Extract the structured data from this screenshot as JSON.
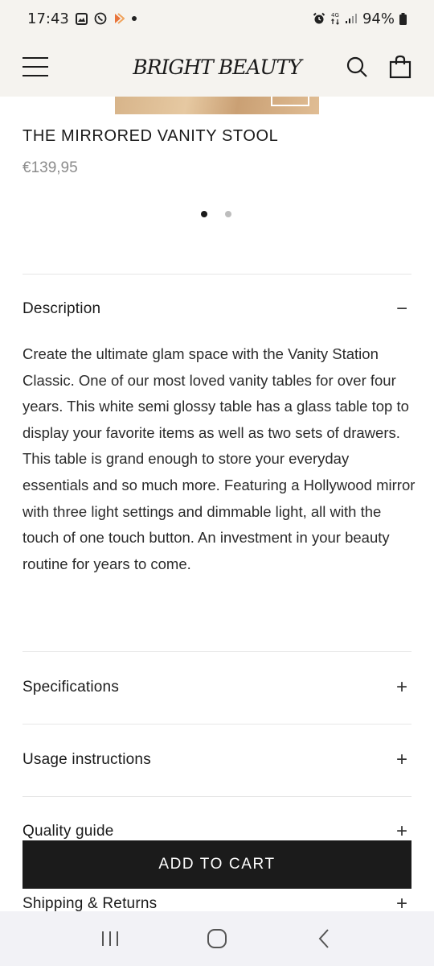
{
  "status_bar": {
    "time": "17:43",
    "battery": "94%"
  },
  "header": {
    "brand": "BRIGHT BEAUTY",
    "menu_icon": "menu-icon",
    "search_icon": "search-icon",
    "bag_icon": "shopping-bag-icon"
  },
  "product": {
    "title": "THE MIRRORED VANITY STOOL",
    "price": "€139,95",
    "carousel": {
      "count": 2,
      "active_index": 1
    }
  },
  "description": {
    "label": "Description",
    "expanded_sign": "−",
    "text": "Create the ultimate glam space with the Vanity Station Classic. One of our most loved vanity tables for over four years. This white semi glossy table has a glass table top to display your favorite items as well as two sets of drawers. This table is grand enough to store your everyday essentials and so much more. Featuring a Hollywood mirror with three light settings and dimmable light, all with the touch of one touch button. An investment in your beauty routine for years to come."
  },
  "accordions": [
    {
      "label": "Specifications",
      "sign": "+"
    },
    {
      "label": "Usage instructions",
      "sign": "+"
    },
    {
      "label": "Quality guide",
      "sign": "+"
    },
    {
      "label": "Shipping & Returns",
      "sign": "+"
    }
  ],
  "cta": {
    "add_to_cart": "ADD TO CART"
  },
  "nav": {
    "recents_icon": "recent-apps-icon",
    "home_icon": "home-icon",
    "back_icon": "back-icon"
  }
}
